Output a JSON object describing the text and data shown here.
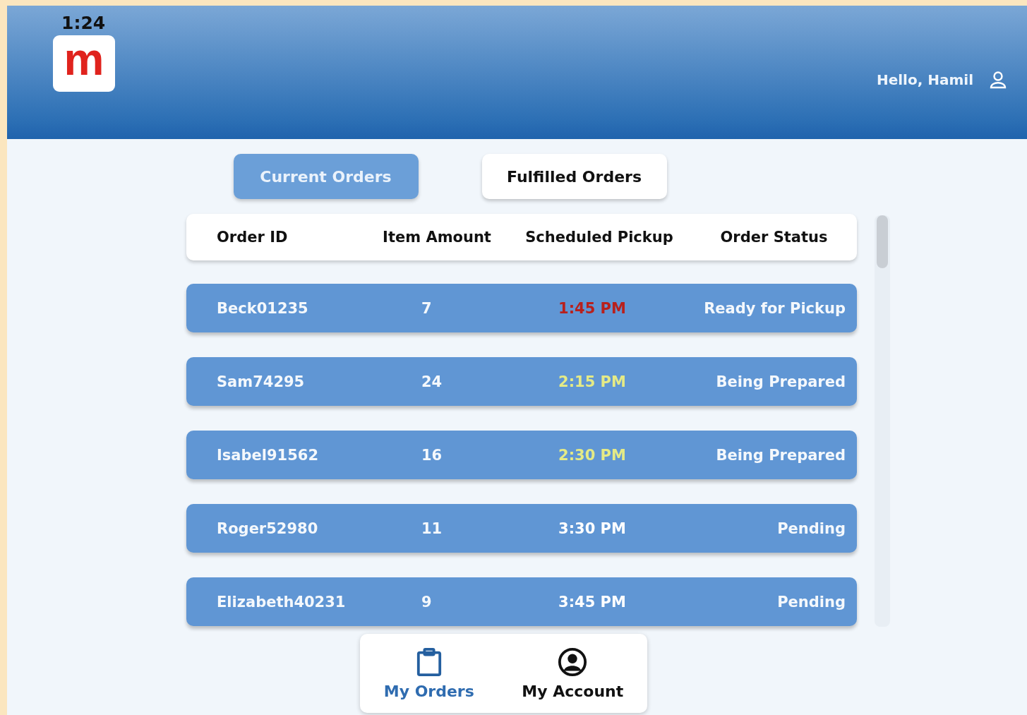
{
  "status_bar": {
    "time": "1:24"
  },
  "header": {
    "logo": "m",
    "greeting": "Hello, Hamil"
  },
  "tabs": [
    {
      "label": "Current Orders",
      "selected": true
    },
    {
      "label": "Fulfilled Orders",
      "selected": false
    }
  ],
  "table": {
    "columns": [
      "Order ID",
      "Item Amount",
      "Scheduled Pickup",
      "Order Status"
    ],
    "rows": [
      {
        "order_id": "Beck01235",
        "item_amount": "7",
        "scheduled_pickup": "1:45 PM",
        "color": "#b8201c",
        "order_status": "Ready for Pickup"
      },
      {
        "order_id": "Sam74295",
        "item_amount": "24",
        "scheduled_pickup": "2:15 PM",
        "color": "#e4ea86",
        "order_status": "Being Prepared"
      },
      {
        "order_id": "Isabel91562",
        "item_amount": "16",
        "scheduled_pickup": "2:30 PM",
        "color": "#e4ea86",
        "order_status": "Being Prepared"
      },
      {
        "order_id": "Roger52980",
        "item_amount": "11",
        "scheduled_pickup": "3:30 PM",
        "color": "#ffffff",
        "order_status": "Pending"
      },
      {
        "order_id": "Elizabeth40231",
        "item_amount": "9",
        "scheduled_pickup": "3:45 PM",
        "color": "#ffffff",
        "order_status": "Pending"
      }
    ]
  },
  "bottom_nav": [
    {
      "label": "My Orders",
      "kind": "clipboard",
      "selected": true
    },
    {
      "label": "My Account",
      "kind": "account",
      "selected": false
    }
  ]
}
